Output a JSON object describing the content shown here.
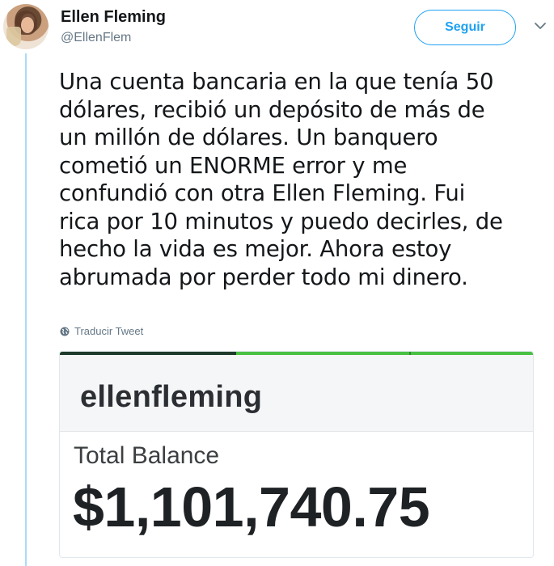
{
  "author": {
    "name": "Ellen Fleming",
    "handle": "@EllenFlem"
  },
  "actions": {
    "follow_label": "Seguir",
    "more_icon": "chevron-down-icon"
  },
  "tweet": {
    "lines": [
      "Una cuenta bancaria en la que tenía 50",
      "dólares, recibió un depósito de más de",
      "un millón de dólares. Un banquero",
      "cometió un ENORME error y me",
      "confundió con otra Ellen Fleming. Fui",
      "rica por 10 minutos y puedo decirles, de",
      "hecho la vida es mejor. Ahora estoy",
      "abrumada por perder todo mi dinero."
    ],
    "translate_label": "Traducir Tweet",
    "translate_icon": "globe-icon"
  },
  "media": {
    "username": "ellenfleming",
    "balance_label": "Total Balance",
    "balance_value": "$1,101,740.75"
  },
  "colors": {
    "accent": "#1da1f2",
    "thread_line": "#a9dcf6",
    "progress_green": "#48c144",
    "progress_dark": "#1e3b2c"
  }
}
